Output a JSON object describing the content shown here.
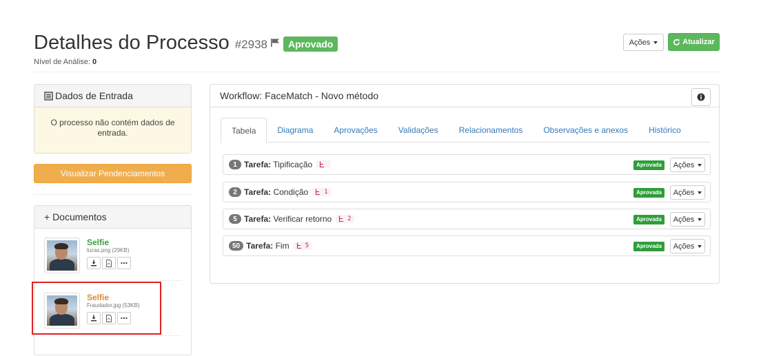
{
  "header": {
    "title": "Detalhes do Processo",
    "process_id": "#2938",
    "status_label": "Aprovado",
    "analysis_label": "Nível de Análise:",
    "analysis_value": "0",
    "actions_label": "Ações",
    "refresh_label": "Atualizar"
  },
  "input_panel": {
    "title": "Dados de Entrada",
    "empty_message": "O processo não contém dados de entrada."
  },
  "pending_button_label": "Visualizar Pendenciamentos",
  "documents_panel": {
    "title": "+ Documentos",
    "items": [
      {
        "title": "Selfie",
        "file": "lucas.png (29KB)",
        "title_color": "#3c9d3c"
      },
      {
        "title": "Selfie",
        "file": "Fraudador.jpg (53KB)",
        "title_color": "#e08a2a"
      }
    ]
  },
  "workflow": {
    "title": "Workflow: FaceMatch - Novo método",
    "tabs": [
      {
        "label": "Tabela",
        "active": true
      },
      {
        "label": "Diagrama",
        "active": false
      },
      {
        "label": "Aprovações",
        "active": false
      },
      {
        "label": "Validações",
        "active": false
      },
      {
        "label": "Relacionamentos",
        "active": false
      },
      {
        "label": "Observações e anexos",
        "active": false
      },
      {
        "label": "Histórico",
        "active": false
      }
    ],
    "task_prefix": "Tarefa:",
    "tasks": [
      {
        "badge": "1",
        "name": "Tipificação",
        "code": "",
        "status": "Aprovada",
        "actions": "Ações"
      },
      {
        "badge": "2",
        "name": "Condição",
        "code": "1",
        "status": "Aprovada",
        "actions": "Ações"
      },
      {
        "badge": "5",
        "name": "Verificar retorno",
        "code": "2",
        "status": "Aprovada",
        "actions": "Ações"
      },
      {
        "badge": "50",
        "name": "Fim",
        "code": "5",
        "status": "Aprovada",
        "actions": "Ações"
      }
    ]
  },
  "colors": {
    "success": "#5cb85c",
    "warning": "#f0ad4e",
    "link": "#337ab7",
    "highlight": "#e02020"
  }
}
